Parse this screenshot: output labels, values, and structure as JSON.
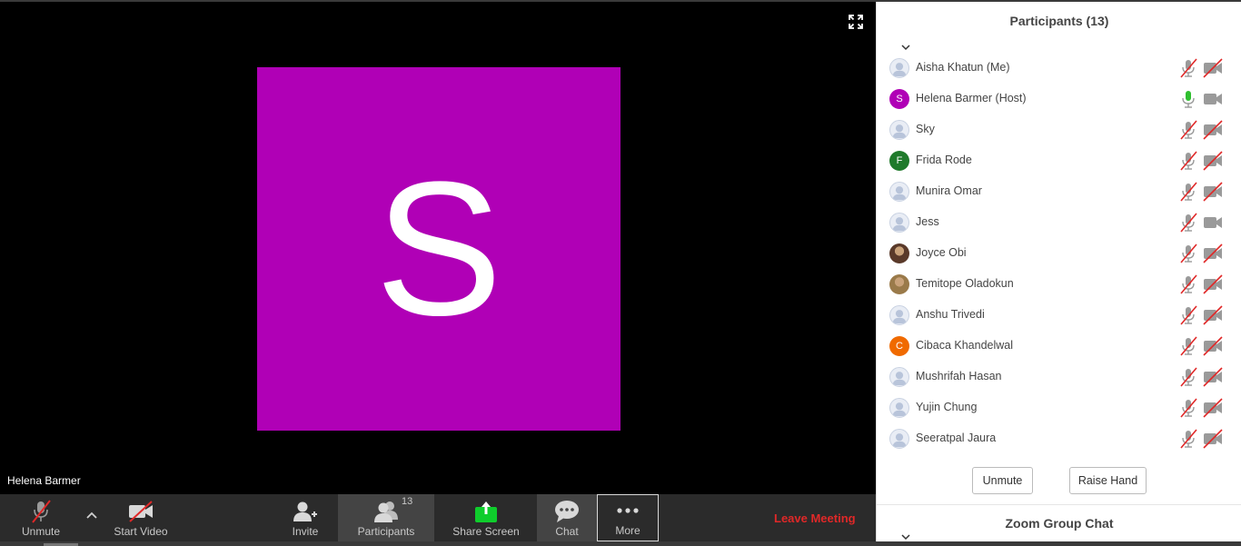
{
  "video": {
    "avatar_letter": "S",
    "avatar_color": "#b000b6",
    "speaker_name": "Helena Barmer"
  },
  "toolbar": {
    "unmute_label": "Unmute",
    "start_video_label": "Start Video",
    "invite_label": "Invite",
    "participants_label": "Participants",
    "participants_count": "13",
    "share_label": "Share Screen",
    "chat_label": "Chat",
    "more_label": "More",
    "leave_label": "Leave Meeting",
    "leave_color": "#e02828",
    "share_color": "#0fcd2c"
  },
  "panel": {
    "title": "Participants (13)",
    "unmute_label": "Unmute",
    "raise_hand_label": "Raise Hand",
    "group_chat_title": "Zoom Group Chat",
    "participants": [
      {
        "name": "Aisha Khatun (Me)",
        "avatar": "generic",
        "mic": "muted",
        "video": "off"
      },
      {
        "name": "Helena Barmer (Host)",
        "avatar": "letter",
        "letter": "S",
        "color": "#b000b6",
        "mic": "on",
        "video": "on"
      },
      {
        "name": "Sky",
        "avatar": "generic",
        "mic": "muted",
        "video": "off"
      },
      {
        "name": "Frida Rode",
        "avatar": "letter",
        "letter": "F",
        "color": "#1f7a2b",
        "mic": "muted",
        "video": "off"
      },
      {
        "name": "Munira Omar",
        "avatar": "generic",
        "mic": "muted",
        "video": "off"
      },
      {
        "name": "Jess",
        "avatar": "generic",
        "mic": "muted",
        "video": "on"
      },
      {
        "name": "Joyce Obi",
        "avatar": "photo",
        "color": "#5a3a2a",
        "mic": "muted",
        "video": "off"
      },
      {
        "name": "Temitope Oladokun",
        "avatar": "photo",
        "color": "#9a7a4a",
        "mic": "muted",
        "video": "off"
      },
      {
        "name": "Anshu Trivedi",
        "avatar": "generic",
        "mic": "muted",
        "video": "off"
      },
      {
        "name": "Cibaca Khandelwal",
        "avatar": "letter",
        "letter": "C",
        "color": "#f06a00",
        "mic": "muted",
        "video": "off"
      },
      {
        "name": "Mushrifah Hasan",
        "avatar": "generic",
        "mic": "muted",
        "video": "off"
      },
      {
        "name": "Yujin Chung",
        "avatar": "generic",
        "mic": "muted",
        "video": "off"
      },
      {
        "name": "Seeratpal Jaura",
        "avatar": "generic",
        "mic": "muted",
        "video": "off"
      }
    ]
  }
}
